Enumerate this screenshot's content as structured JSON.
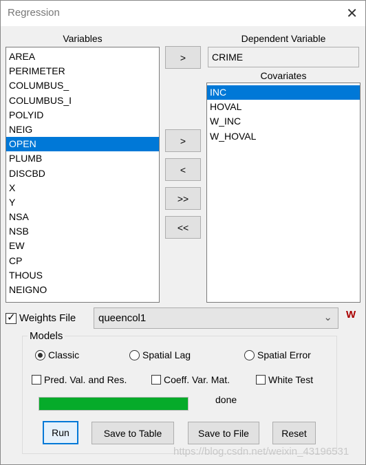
{
  "window": {
    "title": "Regression"
  },
  "variables": {
    "label": "Variables",
    "items": [
      "AREA",
      "PERIMETER",
      "COLUMBUS_",
      "COLUMBUS_I",
      "POLYID",
      "NEIG",
      "OPEN",
      "PLUMB",
      "DISCBD",
      "X",
      "Y",
      "NSA",
      "NSB",
      "EW",
      "CP",
      "THOUS",
      "NEIGNO"
    ],
    "selected": "OPEN"
  },
  "dependent": {
    "label": "Dependent Variable",
    "value": "CRIME"
  },
  "covariates": {
    "label": "Covariates",
    "items": [
      "INC",
      "HOVAL",
      "W_INC",
      "W_HOVAL"
    ],
    "selected": "INC"
  },
  "move_buttons": {
    "to_dependent": ">",
    "add": ">",
    "remove": "<",
    "add_all": ">>",
    "remove_all": "<<"
  },
  "weights": {
    "label": "Weights File",
    "checked": true,
    "value": "queencol1"
  },
  "models": {
    "label": "Models",
    "options": [
      "Classic",
      "Spatial Lag",
      "Spatial Error"
    ],
    "selected": "Classic"
  },
  "options": {
    "pred": "Pred. Val. and Res.",
    "coeff": "Coeff. Var. Mat.",
    "white": "White Test"
  },
  "progress": {
    "percent": 100,
    "status": "done",
    "color": "#06ab2a"
  },
  "buttons": {
    "run": "Run",
    "save_table": "Save to Table",
    "save_file": "Save to File",
    "reset": "Reset"
  },
  "watermark": "https://blog.csdn.net/weixin_43196531"
}
